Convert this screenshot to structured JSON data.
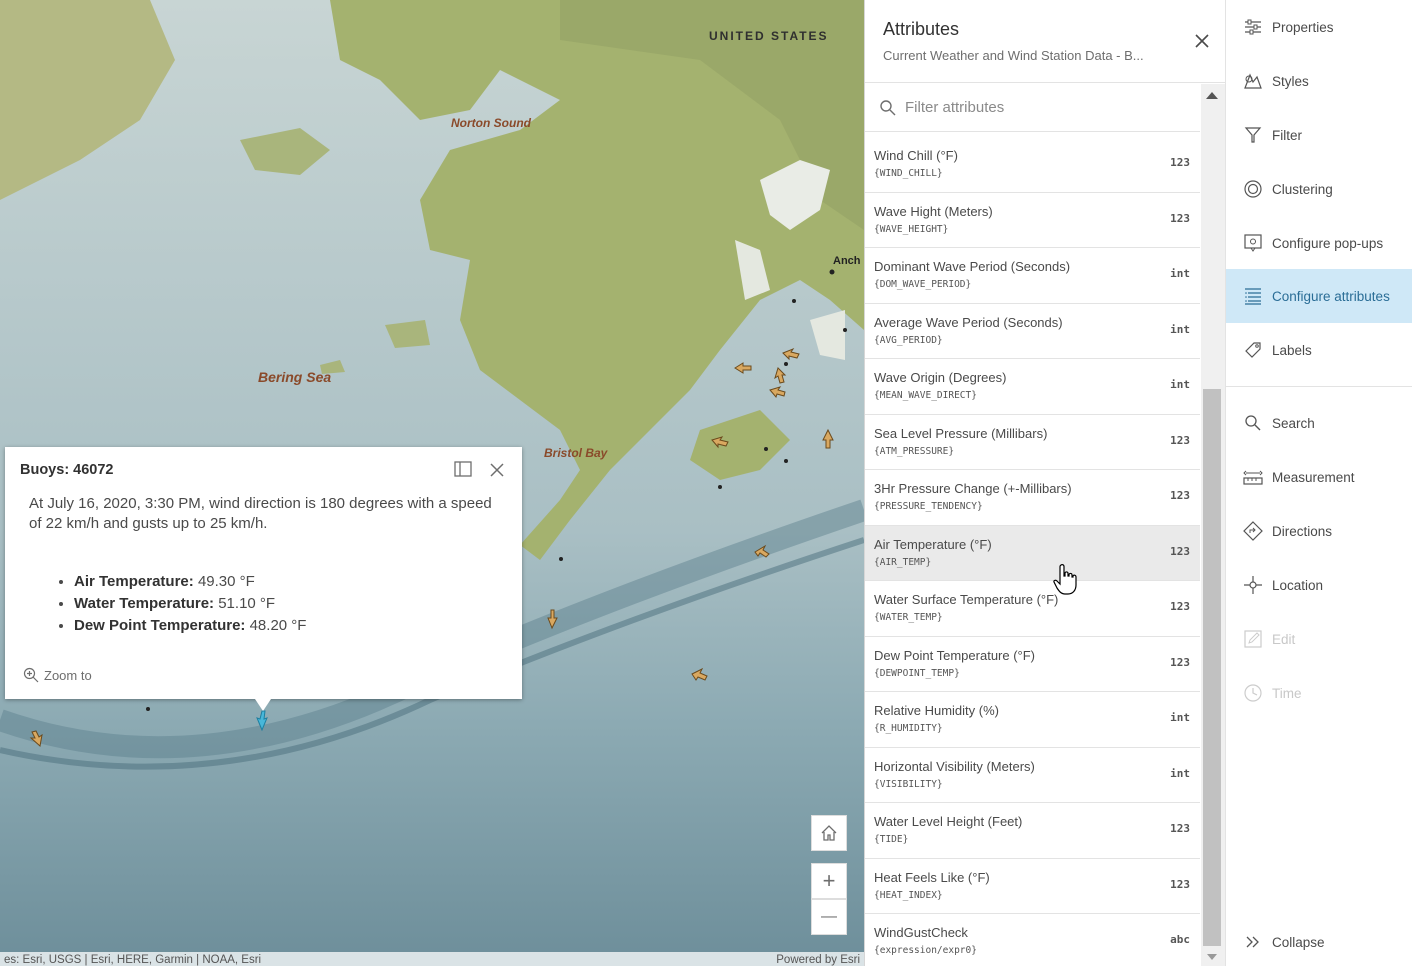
{
  "map": {
    "labels": {
      "country": "UNITED STATES",
      "norton": "Norton Sound",
      "bering": "Bering Sea",
      "bristol": "Bristol Bay",
      "anch": "Anch"
    },
    "attribution_left": "es: Esri, USGS | Esri, HERE, Garmin | NOAA, Esri",
    "attribution_right": "Powered by Esri",
    "controls": {
      "home_icon": "home-icon",
      "zoom_in": "+",
      "zoom_out": "—"
    }
  },
  "popup": {
    "title": "Buoys: 46072",
    "description": "At July 16, 2020, 3:30 PM, wind direction is 180 degrees with a speed of 22 km/h and gusts up to 25 km/h.",
    "items": [
      {
        "label": "Air Temperature:",
        "value": "49.30 °F"
      },
      {
        "label": "Water Temperature:",
        "value": "51.10 °F"
      },
      {
        "label": "Dew Point Temperature:",
        "value": "48.20 °F"
      }
    ],
    "zoom_label": "Zoom to"
  },
  "attributes": {
    "title": "Attributes",
    "subtitle": "Current Weather and Wind Station Data - B...",
    "filter_placeholder": "Filter attributes",
    "rows": [
      {
        "label": "Wind Chill (°F)",
        "field": "{WIND_CHILL}",
        "type": "123"
      },
      {
        "label": "Wave Hight (Meters)",
        "field": "{WAVE_HEIGHT}",
        "type": "123"
      },
      {
        "label": "Dominant Wave Period (Seconds)",
        "field": "{DOM_WAVE_PERIOD}",
        "type": "int"
      },
      {
        "label": "Average Wave Period (Seconds)",
        "field": "{AVG_PERIOD}",
        "type": "int"
      },
      {
        "label": "Wave Origin (Degrees)",
        "field": "{MEAN_WAVE_DIRECT}",
        "type": "int"
      },
      {
        "label": "Sea Level Pressure (Millibars)",
        "field": "{ATM_PRESSURE}",
        "type": "123"
      },
      {
        "label": "3Hr Pressure Change (+-Millibars)",
        "field": "{PRESSURE_TENDENCY}",
        "type": "123"
      },
      {
        "label": "Air Temperature (°F)",
        "field": "{AIR_TEMP}",
        "type": "123"
      },
      {
        "label": "Water Surface Temperature (°F)",
        "field": "{WATER_TEMP}",
        "type": "123"
      },
      {
        "label": "Dew Point Temperature (°F)",
        "field": "{DEWPOINT_TEMP}",
        "type": "123"
      },
      {
        "label": "Relative Humidity (%)",
        "field": "{R_HUMIDITY}",
        "type": "int"
      },
      {
        "label": "Horizontal Visibility (Meters)",
        "field": "{VISIBILITY}",
        "type": "int"
      },
      {
        "label": "Water Level Height (Feet)",
        "field": "{TIDE}",
        "type": "123"
      },
      {
        "label": "Heat Feels Like (°F)",
        "field": "{HEAT_INDEX}",
        "type": "123"
      },
      {
        "label": "WindGustCheck",
        "field": "{expression/expr0}",
        "type": "abc"
      }
    ]
  },
  "tools": [
    {
      "label": "Properties",
      "icon": "properties-icon"
    },
    {
      "label": "Styles",
      "icon": "styles-icon"
    },
    {
      "label": "Filter",
      "icon": "filter-icon"
    },
    {
      "label": "Clustering",
      "icon": "clustering-icon"
    },
    {
      "label": "Configure pop-ups",
      "icon": "popup-icon"
    },
    {
      "label": "Configure attributes",
      "icon": "attributes-icon",
      "active": true
    },
    {
      "label": "Labels",
      "icon": "labels-icon"
    },
    {
      "label": "Search",
      "icon": "search-icon"
    },
    {
      "label": "Measurement",
      "icon": "measurement-icon"
    },
    {
      "label": "Directions",
      "icon": "directions-icon"
    },
    {
      "label": "Location",
      "icon": "location-icon"
    },
    {
      "label": "Edit",
      "icon": "edit-icon",
      "disabled": true
    },
    {
      "label": "Time",
      "icon": "time-icon",
      "disabled": true
    },
    {
      "label": "Collapse",
      "icon": "collapse-icon"
    }
  ],
  "colors": {
    "active_bg": "#cfe8f7",
    "active_text": "#2a6d96",
    "land": "#a8b77a",
    "water": "#aabfc3"
  }
}
